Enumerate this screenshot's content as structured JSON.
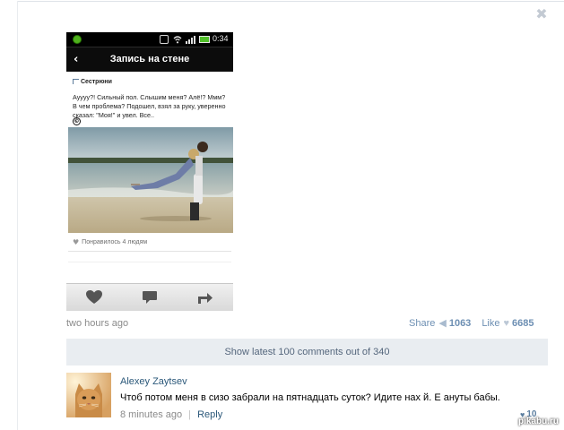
{
  "window": {
    "close_icon": "close-icon",
    "close_glyph": "✖"
  },
  "phone": {
    "status": {
      "time": "0:34",
      "battery_color": "#51c02a"
    },
    "appbar": {
      "back_glyph": "‹",
      "title": "Запись на стене"
    },
    "post": {
      "group_name": "Сестрюни",
      "text": "Ауууу?! Сильный пол. Слышим меня? Алё!? Ммм? В чем проблема? Подошел, взял за руку, уверенно сказал: \"Моя!\" и увел. Все..",
      "copyright_glyph": "©",
      "likes_text": "Понравилось 4 людям",
      "heart_glyph": "♥"
    },
    "actions": [
      "heart-icon",
      "comment-icon",
      "share-icon"
    ]
  },
  "meta": {
    "time": "two hours ago",
    "share_label": "Share",
    "share_icon_glyph": "◀",
    "share_count": "1063",
    "like_label": "Like",
    "like_icon_glyph": "♥",
    "like_count": "6685"
  },
  "show_comments_label": "Show latest 100 comments out of 340",
  "comment": {
    "author": "Alexey Zaytsev",
    "text": "Чтоб потом меня в сизо забрали на пятнадцать суток? Идите нах  й. Е  ануты бабы.",
    "time": "8 minutes ago",
    "separator": "|",
    "reply_label": "Reply",
    "like_glyph": "♥",
    "like_count": "10"
  },
  "watermark": "pikabu.ru",
  "colors": {
    "link": "#2b587a",
    "muted": "#8a8a8a",
    "bar": "#e9edf1"
  }
}
